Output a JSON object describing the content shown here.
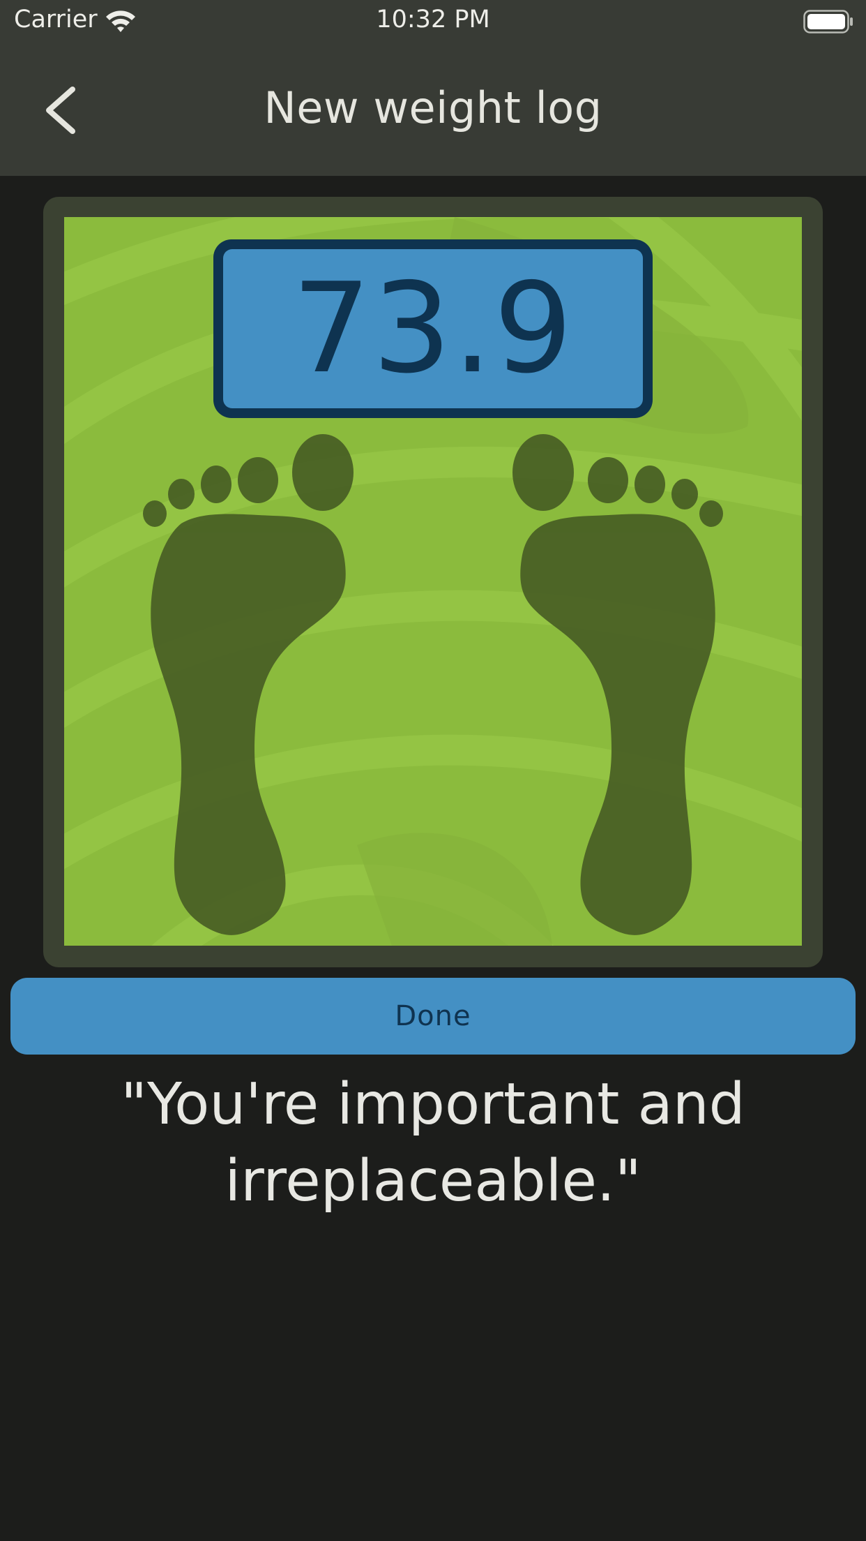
{
  "status_bar": {
    "carrier": "Carrier",
    "time": "10:32 PM",
    "icons": [
      "wifi-icon",
      "battery-icon"
    ]
  },
  "nav": {
    "title": "New weight log",
    "back_icon": "chevron-left-icon"
  },
  "scale": {
    "reading": "73.9",
    "icons": [
      "left-footprint-icon",
      "right-footprint-icon"
    ]
  },
  "done_label": "Done",
  "quote": "\"You're important and irreplaceable.\"",
  "colors": {
    "bar": "#383b35",
    "background": "#1c1d1b",
    "scale_green": "#8bbb3d",
    "scale_frame": "#3b4232",
    "display_blue": "#4490c4",
    "display_border": "#0e3350",
    "footprint": "#465c23",
    "text_light": "#e6e6df"
  }
}
